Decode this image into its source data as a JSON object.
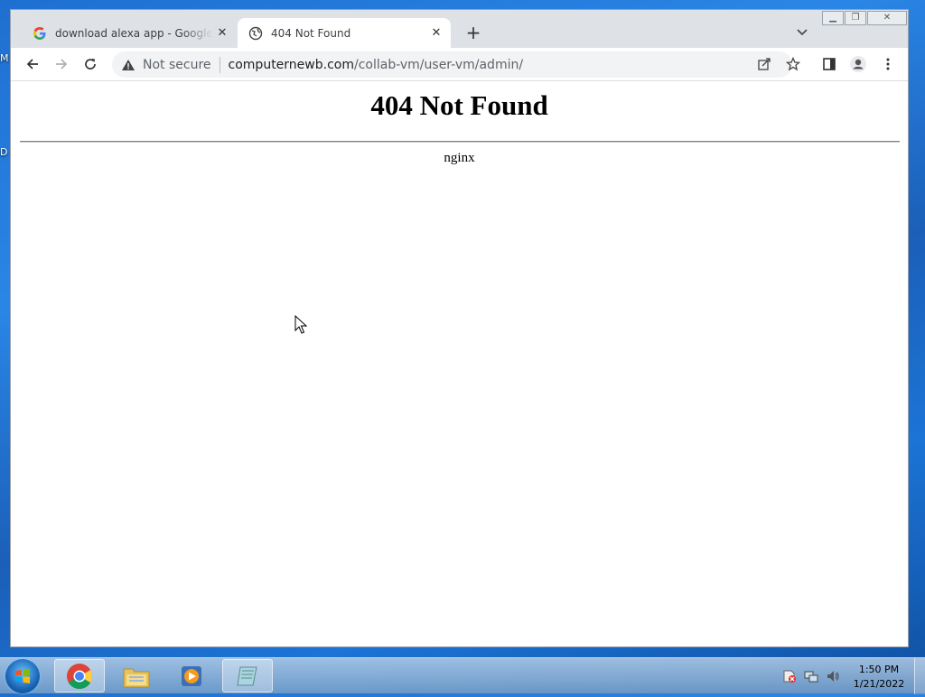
{
  "browser": {
    "tabs": [
      {
        "title": "download alexa app - Google Se",
        "favicon": "google-icon",
        "active": false
      },
      {
        "title": "404 Not Found",
        "favicon": "globe-icon",
        "active": true
      }
    ],
    "new_tab_symbol": "+",
    "address": {
      "security_label": "Not secure",
      "domain": "computernewb.com",
      "path": "/collab-vm/user-vm/admin/"
    }
  },
  "page": {
    "heading": "404 Not Found",
    "server": "nginx"
  },
  "desktop": {
    "icon_labels": [
      "M",
      "D"
    ]
  },
  "taskbar": {
    "time": "1:50 PM",
    "date": "1/21/2022"
  }
}
